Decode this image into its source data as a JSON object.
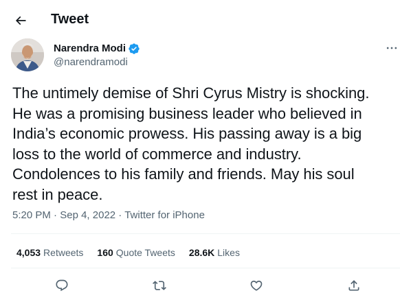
{
  "header": {
    "title": "Tweet"
  },
  "author": {
    "name": "Narendra Modi",
    "handle": "@narendramodi"
  },
  "tweet": {
    "text": "The untimely demise of Shri Cyrus Mistry is shocking.\nHe was a promising business leader who believed in\nIndia’s economic prowess. His passing away is a big\nloss to the world of commerce and industry.\nCondolences to his family and friends. May his soul\nrest in peace.",
    "time": "5:20 PM",
    "separator": "·",
    "date": "Sep 4, 2022",
    "source": "Twitter for iPhone"
  },
  "stats": {
    "retweets_count": "4,053",
    "retweets_label": "Retweets",
    "quotes_count": "160",
    "quotes_label": "Quote Tweets",
    "likes_count": "28.6K",
    "likes_label": "Likes"
  },
  "icons": {
    "back": "arrow-left-icon",
    "verified": "verified-badge-icon",
    "more": "more-horizontal-icon",
    "reply": "reply-icon",
    "retweet": "retweet-icon",
    "like": "heart-icon",
    "share": "share-icon"
  },
  "colors": {
    "verified": "#1d9bf0",
    "text": "#0f1419",
    "secondary": "#536471",
    "divider": "#eff3f4"
  }
}
